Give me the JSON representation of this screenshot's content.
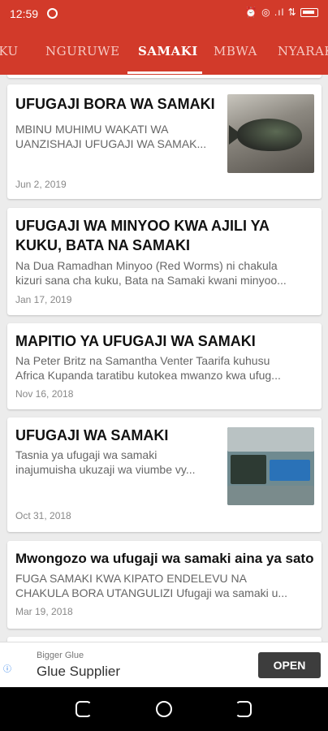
{
  "status_bar": {
    "time": "12:59",
    "right_icons": "⏰ ◎ .ıl ⇅"
  },
  "tabs": [
    {
      "label": "KUKU"
    },
    {
      "label": "NGURUWE"
    },
    {
      "label": "SAMAKI"
    },
    {
      "label": "MBWA"
    },
    {
      "label": "NYARAKA"
    }
  ],
  "active_tab": "SAMAKI",
  "articles": [
    {
      "title": "UFUGAJI BORA WA SAMAKI",
      "excerpt": "MBINU MUHIMU WAKATI WA\nUANZISHAJI UFUGAJI WA SAMAK...",
      "date": "Jun 2, 2019",
      "thumb": "tilapia-fish-image"
    },
    {
      "title": "UFUGAJI WA MINYOO KWA AJILI YA KUKU, BATA NA SAMAKI",
      "excerpt": "Na Dua Ramadhan Minyoo (Red Worms) ni chakula\nkizuri sana cha kuku, Bata na Samaki kwani minyoo...",
      "date": "Jan 17, 2019"
    },
    {
      "title": "MAPITIO YA UFUGAJI WA SAMAKI",
      "excerpt": "Na Peter Britz na Samantha Venter Taarifa kuhusu\nAfrica Kupanda taratibu kutokea mwanzo kwa ufug...",
      "date": "Nov 16, 2018"
    },
    {
      "title": "UFUGAJI WA SAMAKI",
      "excerpt": "Tasnia ya ufugaji wa samaki\ninajumuisha ukuzaji wa viumbe vy...",
      "date": "Oct 31, 2018",
      "thumb": "fish-farm-tanks-image"
    },
    {
      "title": "Mwongozo wa ufugaji wa samaki aina ya sato",
      "excerpt": "FUGA SAMAKI KWA KIPATO ENDELEVU NA\nCHAKULA BORA UTANGULIZI Ufugaji wa samaki u...",
      "date": "Mar 19, 2018"
    }
  ],
  "ad": {
    "subtitle": "Bigger Glue",
    "title": "Glue Supplier",
    "button": "OPEN"
  },
  "colors": {
    "header": "#d23a2a",
    "background": "#ececec"
  }
}
